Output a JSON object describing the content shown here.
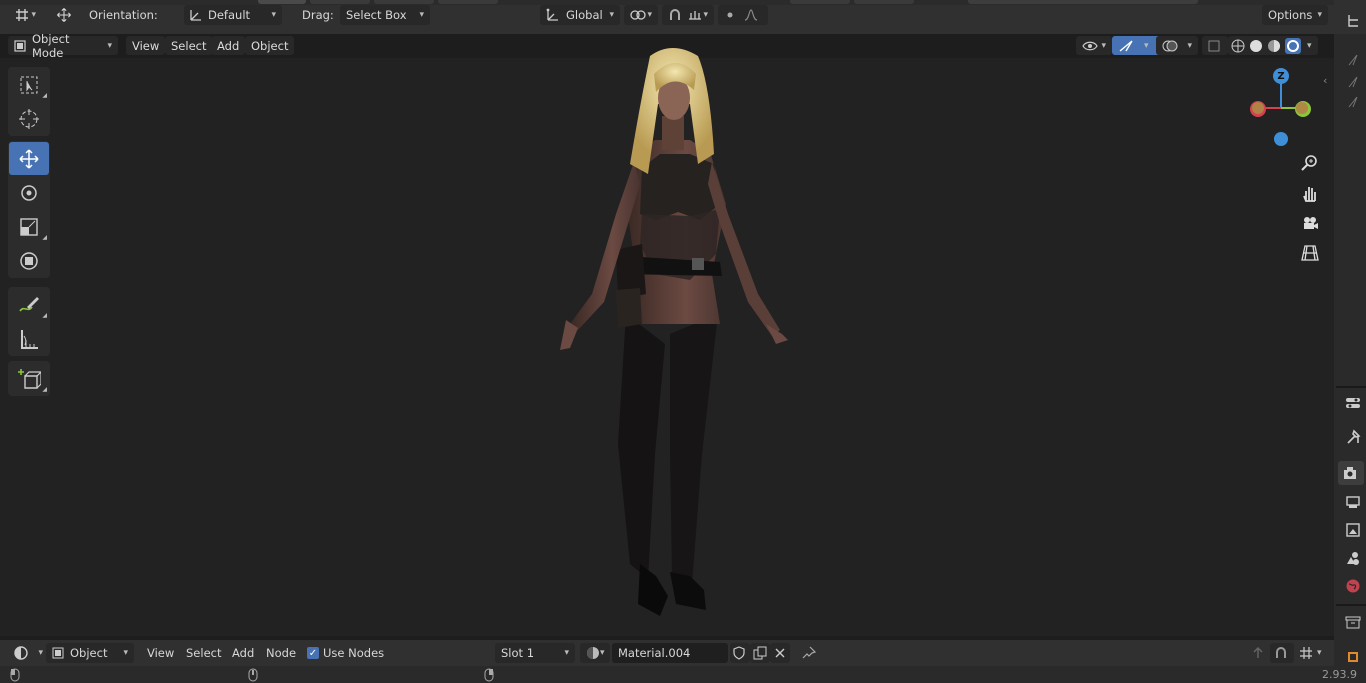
{
  "header": {
    "orientation_label": "Orientation:",
    "orientation_value": "Default",
    "drag_label": "Drag:",
    "drag_value": "Select Box",
    "transform_space": "Global",
    "options_label": "Options"
  },
  "viewport_header": {
    "mode": "Object Mode",
    "menus": [
      "View",
      "Select",
      "Add",
      "Object"
    ]
  },
  "navigation_gizmo": {
    "axis_label": "Z"
  },
  "toolbar": {
    "tools": [
      "select-box",
      "cursor",
      "move",
      "rotate",
      "scale",
      "transform",
      "annotate",
      "measure",
      "add-cube"
    ],
    "active_tool": "move"
  },
  "shader_editor_header": {
    "editor_type": "Object",
    "menus": [
      "View",
      "Select",
      "Add",
      "Node"
    ],
    "use_nodes_label": "Use Nodes",
    "use_nodes_checked": true,
    "slot": "Slot 1",
    "material_name": "Material.004"
  },
  "status_bar": {
    "version": "2.93.9"
  },
  "colors": {
    "accent": "#4772b3",
    "x_axis": "#d6404f",
    "y_axis": "#8cc43b",
    "z_axis": "#3f8ed8",
    "viewport_bg": "#222222",
    "header_bg": "#303030"
  }
}
